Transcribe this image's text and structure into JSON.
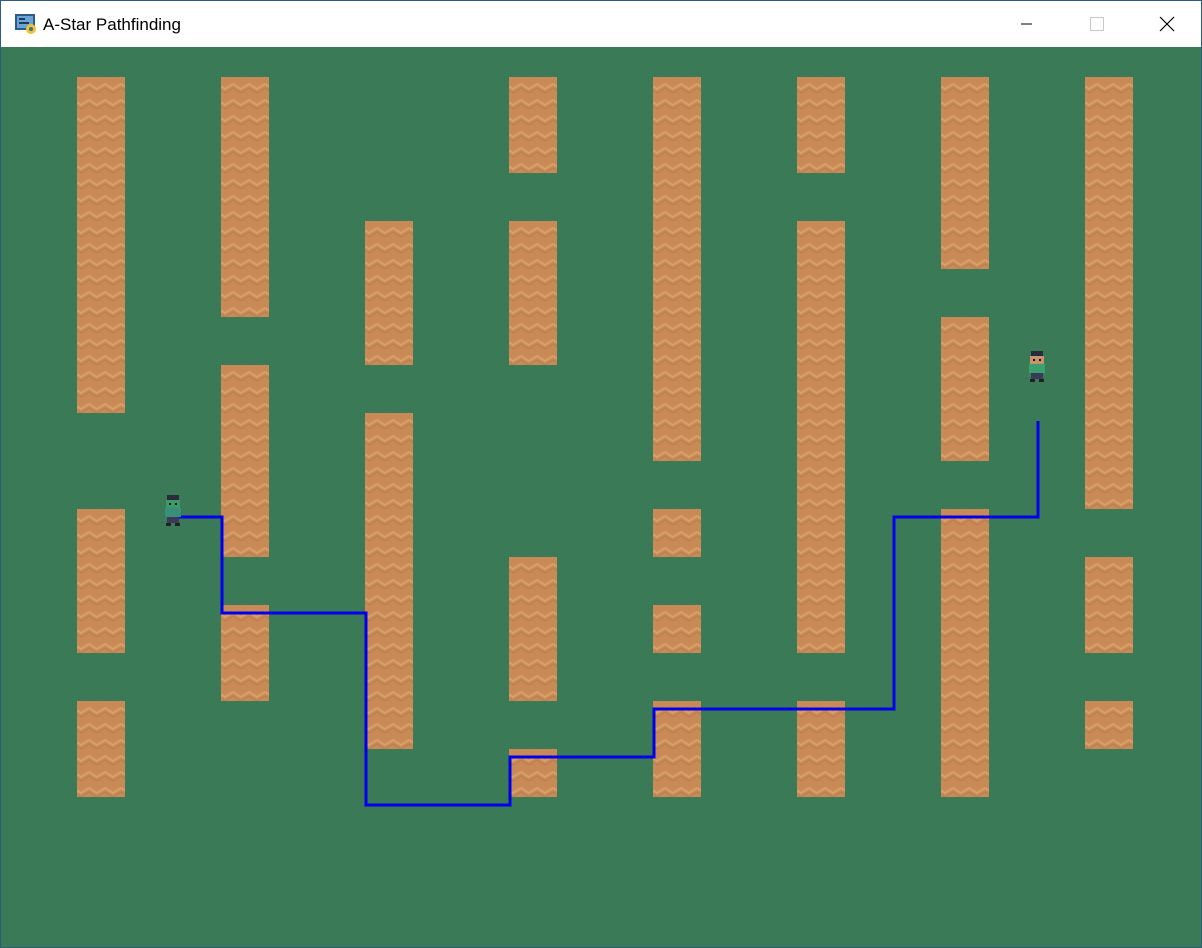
{
  "window": {
    "title": "A-Star Pathfinding",
    "title_icon": "python-app-icon",
    "controls": [
      "minimize-icon",
      "maximize-icon",
      "close-icon"
    ]
  },
  "colors": {
    "grass": "#3b7a57",
    "wall": "#c98a58",
    "wall_zigzag": "#d9a06c",
    "path": "#0000ee"
  },
  "grid": {
    "cell_label": "48px tiles",
    "cols": 25,
    "rows": 18
  },
  "walls": [
    {
      "col": 1,
      "row": 0,
      "h": 7
    },
    {
      "col": 1,
      "row": 9,
      "h": 3
    },
    {
      "col": 1,
      "row": 13,
      "h": 2
    },
    {
      "col": 4,
      "row": 0,
      "h": 5
    },
    {
      "col": 4,
      "row": 6,
      "h": 4
    },
    {
      "col": 4,
      "row": 11,
      "h": 2
    },
    {
      "col": 7,
      "row": 3,
      "h": 3
    },
    {
      "col": 7,
      "row": 7,
      "h": 7
    },
    {
      "col": 10,
      "row": 0,
      "h": 2
    },
    {
      "col": 10,
      "row": 3,
      "h": 3
    },
    {
      "col": 10,
      "row": 10,
      "h": 3
    },
    {
      "col": 10,
      "row": 14,
      "h": 1
    },
    {
      "col": 13,
      "row": 0,
      "h": 8
    },
    {
      "col": 13,
      "row": 9,
      "h": 1
    },
    {
      "col": 13,
      "row": 11,
      "h": 1
    },
    {
      "col": 13,
      "row": 13,
      "h": 2
    },
    {
      "col": 16,
      "row": 0,
      "h": 2
    },
    {
      "col": 16,
      "row": 3,
      "h": 9
    },
    {
      "col": 16,
      "row": 13,
      "h": 2
    },
    {
      "col": 19,
      "row": 0,
      "h": 4
    },
    {
      "col": 19,
      "row": 5,
      "h": 3
    },
    {
      "col": 19,
      "row": 9,
      "h": 6
    },
    {
      "col": 22,
      "row": 0,
      "h": 9
    },
    {
      "col": 22,
      "row": 10,
      "h": 2
    },
    {
      "col": 22,
      "row": 13,
      "h": 1
    }
  ],
  "path": [
    [
      3,
      9
    ],
    [
      4,
      9
    ],
    [
      4,
      11
    ],
    [
      7,
      11
    ],
    [
      7,
      15
    ],
    [
      10,
      15
    ],
    [
      10,
      14
    ],
    [
      13,
      14
    ],
    [
      13,
      13
    ],
    [
      18,
      13
    ],
    [
      18,
      9
    ],
    [
      21,
      9
    ],
    [
      21,
      7
    ]
  ],
  "characters": [
    {
      "name": "start-character",
      "col": 3,
      "row": 9,
      "shirt": "#3a8f7a",
      "skin": "#3a9a6a"
    },
    {
      "name": "goal-character",
      "col": 21,
      "row": 6,
      "shirt": "#3aa070",
      "skin": "#c8926a"
    }
  ]
}
